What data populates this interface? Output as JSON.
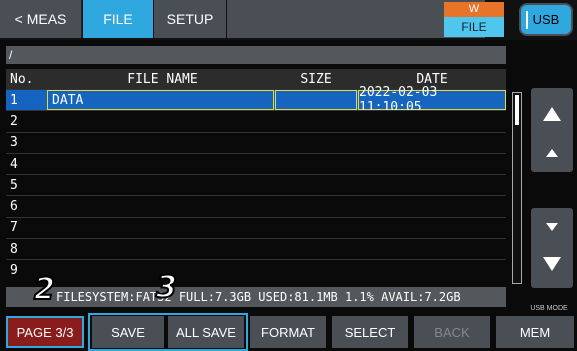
{
  "tabs": {
    "meas": "< MEAS",
    "file": "FILE",
    "setup": "SETUP"
  },
  "mode": {
    "top": "W",
    "bottom": "FILE"
  },
  "usb_label": "USB",
  "path": "/",
  "table": {
    "headers": {
      "no": "No.",
      "name": "FILE NAME",
      "size": "SIZE",
      "date": "DATE"
    },
    "rows": [
      {
        "no": "1",
        "name": "DATA",
        "size": "",
        "date": "2022-02-03 11:10:05"
      },
      {
        "no": "2",
        "name": "",
        "size": "",
        "date": ""
      },
      {
        "no": "3",
        "name": "",
        "size": "",
        "date": ""
      },
      {
        "no": "4",
        "name": "",
        "size": "",
        "date": ""
      },
      {
        "no": "5",
        "name": "",
        "size": "",
        "date": ""
      },
      {
        "no": "6",
        "name": "",
        "size": "",
        "date": ""
      },
      {
        "no": "7",
        "name": "",
        "size": "",
        "date": ""
      },
      {
        "no": "8",
        "name": "",
        "size": "",
        "date": ""
      },
      {
        "no": "9",
        "name": "",
        "size": "",
        "date": ""
      }
    ]
  },
  "status": "FILESYSTEM:FAT32  FULL:7.3GB  USED:81.1MB  1.1%  AVAIL:7.2GB",
  "usb_mode": "USB MODE",
  "buttons": {
    "page": "PAGE 3/3",
    "save": "SAVE",
    "all_save": "ALL SAVE",
    "format": "FORMAT",
    "select": "SELECT",
    "back": "BACK",
    "mem": "MEM"
  },
  "callouts": {
    "a": "2",
    "b": "3"
  },
  "colors": {
    "accent": "#2fa8e0",
    "selection": "#1565c0",
    "page_button": "#8a1c1c",
    "mode_top": "#e8742a"
  }
}
